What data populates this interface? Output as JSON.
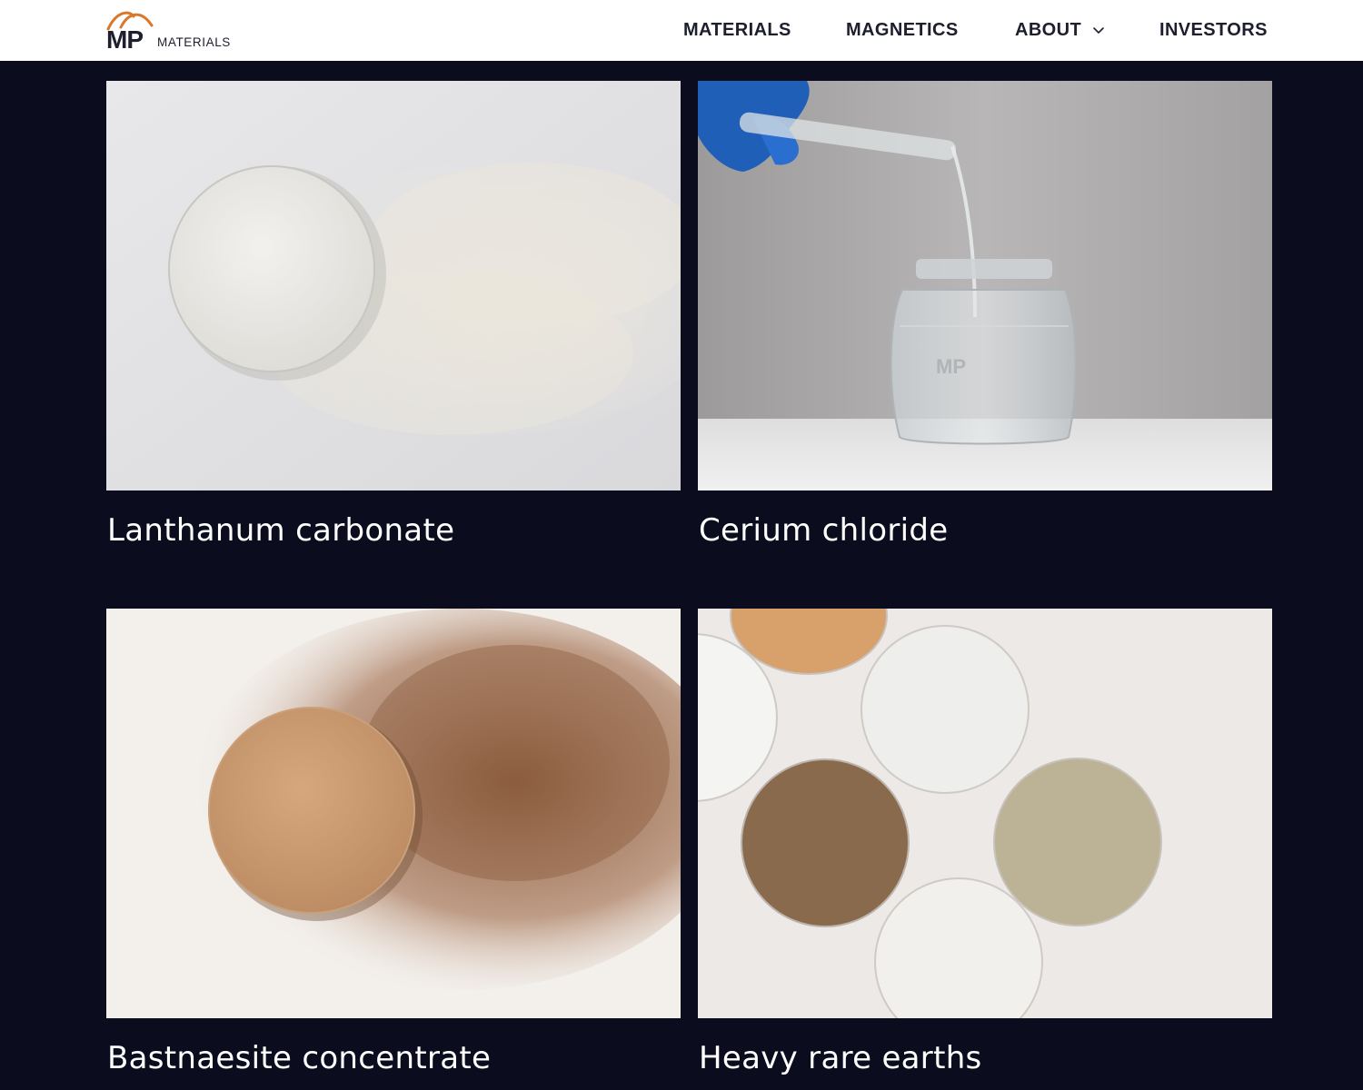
{
  "header": {
    "logo": {
      "mark": "MP",
      "wordmark": "MATERIALS"
    },
    "nav": {
      "items": [
        {
          "label": "MATERIALS",
          "has_dropdown": false
        },
        {
          "label": "MAGNETICS",
          "has_dropdown": false
        },
        {
          "label": "ABOUT",
          "has_dropdown": true
        },
        {
          "label": "INVESTORS",
          "has_dropdown": false
        }
      ]
    }
  },
  "products": [
    {
      "title": "Lanthanum carbonate",
      "image": "white-powder-dish-photo"
    },
    {
      "title": "Cerium chloride",
      "image": "liquid-pour-jar-photo"
    },
    {
      "title": "Bastnaesite concentrate",
      "image": "tan-powder-dish-photo"
    },
    {
      "title": "Heavy rare earths",
      "image": "five-powder-dishes-photo"
    }
  ],
  "colors": {
    "background": "#0b0c1e",
    "header_bg": "#ffffff",
    "nav_text": "#1d1f2e",
    "caption_text": "#ffffff",
    "logo_accent": "#d9772b"
  }
}
